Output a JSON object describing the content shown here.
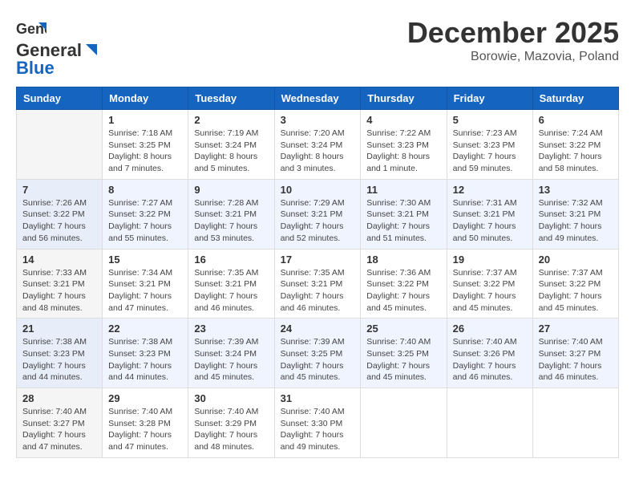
{
  "header": {
    "logo_general": "General",
    "logo_blue": "Blue",
    "month": "December 2025",
    "location": "Borowie, Mazovia, Poland"
  },
  "days_of_week": [
    "Sunday",
    "Monday",
    "Tuesday",
    "Wednesday",
    "Thursday",
    "Friday",
    "Saturday"
  ],
  "weeks": [
    [
      {
        "day": "",
        "info": ""
      },
      {
        "day": "1",
        "info": "Sunrise: 7:18 AM\nSunset: 3:25 PM\nDaylight: 8 hours\nand 7 minutes."
      },
      {
        "day": "2",
        "info": "Sunrise: 7:19 AM\nSunset: 3:24 PM\nDaylight: 8 hours\nand 5 minutes."
      },
      {
        "day": "3",
        "info": "Sunrise: 7:20 AM\nSunset: 3:24 PM\nDaylight: 8 hours\nand 3 minutes."
      },
      {
        "day": "4",
        "info": "Sunrise: 7:22 AM\nSunset: 3:23 PM\nDaylight: 8 hours\nand 1 minute."
      },
      {
        "day": "5",
        "info": "Sunrise: 7:23 AM\nSunset: 3:23 PM\nDaylight: 7 hours\nand 59 minutes."
      },
      {
        "day": "6",
        "info": "Sunrise: 7:24 AM\nSunset: 3:22 PM\nDaylight: 7 hours\nand 58 minutes."
      }
    ],
    [
      {
        "day": "7",
        "info": "Sunrise: 7:26 AM\nSunset: 3:22 PM\nDaylight: 7 hours\nand 56 minutes."
      },
      {
        "day": "8",
        "info": "Sunrise: 7:27 AM\nSunset: 3:22 PM\nDaylight: 7 hours\nand 55 minutes."
      },
      {
        "day": "9",
        "info": "Sunrise: 7:28 AM\nSunset: 3:21 PM\nDaylight: 7 hours\nand 53 minutes."
      },
      {
        "day": "10",
        "info": "Sunrise: 7:29 AM\nSunset: 3:21 PM\nDaylight: 7 hours\nand 52 minutes."
      },
      {
        "day": "11",
        "info": "Sunrise: 7:30 AM\nSunset: 3:21 PM\nDaylight: 7 hours\nand 51 minutes."
      },
      {
        "day": "12",
        "info": "Sunrise: 7:31 AM\nSunset: 3:21 PM\nDaylight: 7 hours\nand 50 minutes."
      },
      {
        "day": "13",
        "info": "Sunrise: 7:32 AM\nSunset: 3:21 PM\nDaylight: 7 hours\nand 49 minutes."
      }
    ],
    [
      {
        "day": "14",
        "info": "Sunrise: 7:33 AM\nSunset: 3:21 PM\nDaylight: 7 hours\nand 48 minutes."
      },
      {
        "day": "15",
        "info": "Sunrise: 7:34 AM\nSunset: 3:21 PM\nDaylight: 7 hours\nand 47 minutes."
      },
      {
        "day": "16",
        "info": "Sunrise: 7:35 AM\nSunset: 3:21 PM\nDaylight: 7 hours\nand 46 minutes."
      },
      {
        "day": "17",
        "info": "Sunrise: 7:35 AM\nSunset: 3:21 PM\nDaylight: 7 hours\nand 46 minutes."
      },
      {
        "day": "18",
        "info": "Sunrise: 7:36 AM\nSunset: 3:22 PM\nDaylight: 7 hours\nand 45 minutes."
      },
      {
        "day": "19",
        "info": "Sunrise: 7:37 AM\nSunset: 3:22 PM\nDaylight: 7 hours\nand 45 minutes."
      },
      {
        "day": "20",
        "info": "Sunrise: 7:37 AM\nSunset: 3:22 PM\nDaylight: 7 hours\nand 45 minutes."
      }
    ],
    [
      {
        "day": "21",
        "info": "Sunrise: 7:38 AM\nSunset: 3:23 PM\nDaylight: 7 hours\nand 44 minutes."
      },
      {
        "day": "22",
        "info": "Sunrise: 7:38 AM\nSunset: 3:23 PM\nDaylight: 7 hours\nand 44 minutes."
      },
      {
        "day": "23",
        "info": "Sunrise: 7:39 AM\nSunset: 3:24 PM\nDaylight: 7 hours\nand 45 minutes."
      },
      {
        "day": "24",
        "info": "Sunrise: 7:39 AM\nSunset: 3:25 PM\nDaylight: 7 hours\nand 45 minutes."
      },
      {
        "day": "25",
        "info": "Sunrise: 7:40 AM\nSunset: 3:25 PM\nDaylight: 7 hours\nand 45 minutes."
      },
      {
        "day": "26",
        "info": "Sunrise: 7:40 AM\nSunset: 3:26 PM\nDaylight: 7 hours\nand 46 minutes."
      },
      {
        "day": "27",
        "info": "Sunrise: 7:40 AM\nSunset: 3:27 PM\nDaylight: 7 hours\nand 46 minutes."
      }
    ],
    [
      {
        "day": "28",
        "info": "Sunrise: 7:40 AM\nSunset: 3:27 PM\nDaylight: 7 hours\nand 47 minutes."
      },
      {
        "day": "29",
        "info": "Sunrise: 7:40 AM\nSunset: 3:28 PM\nDaylight: 7 hours\nand 47 minutes."
      },
      {
        "day": "30",
        "info": "Sunrise: 7:40 AM\nSunset: 3:29 PM\nDaylight: 7 hours\nand 48 minutes."
      },
      {
        "day": "31",
        "info": "Sunrise: 7:40 AM\nSunset: 3:30 PM\nDaylight: 7 hours\nand 49 minutes."
      },
      {
        "day": "",
        "info": ""
      },
      {
        "day": "",
        "info": ""
      },
      {
        "day": "",
        "info": ""
      }
    ]
  ]
}
